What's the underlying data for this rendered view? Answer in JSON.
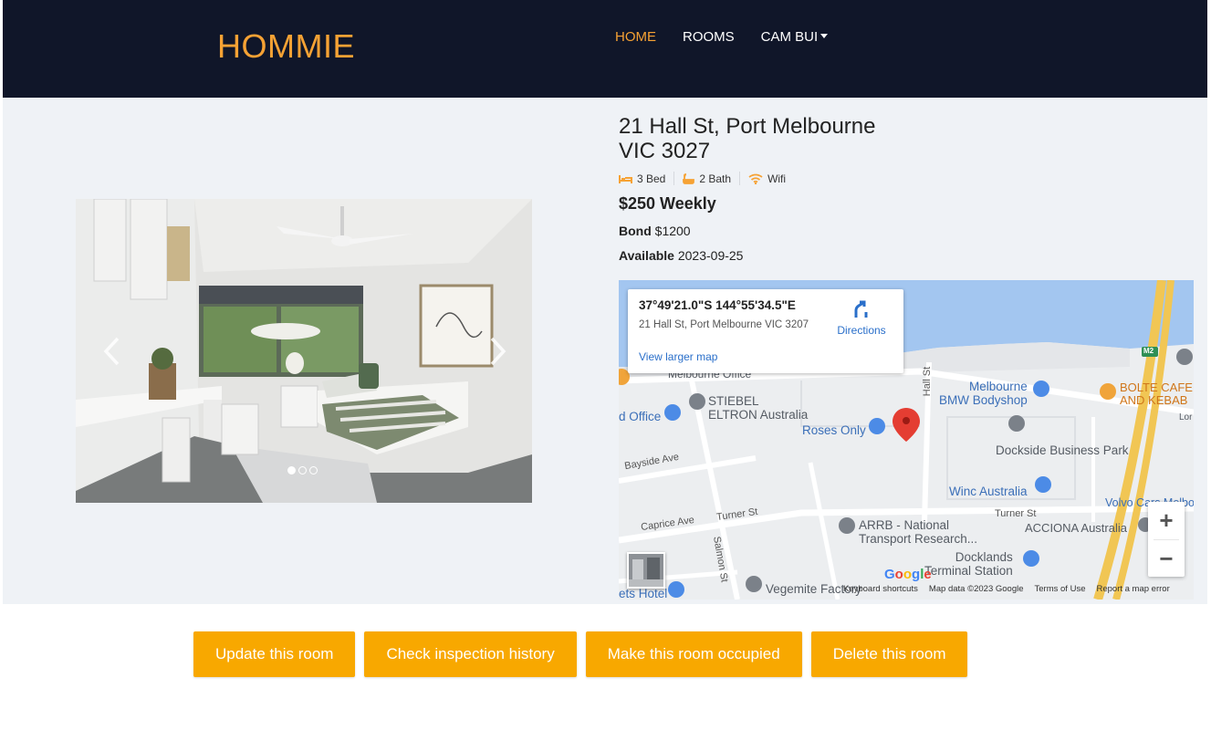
{
  "navbar": {
    "brand": "HOMMIE",
    "links": [
      {
        "label": "HOME",
        "active": true
      },
      {
        "label": "ROOMS",
        "active": false
      },
      {
        "label": "CAM BUI",
        "active": false
      }
    ]
  },
  "carousel": {
    "slide_count": 3,
    "active_index": 0
  },
  "listing": {
    "address_line1": "21 Hall St, Port Melbourne",
    "address_line2": "VIC 3027",
    "features": [
      {
        "icon": "bed-icon",
        "label": "3 Bed"
      },
      {
        "icon": "bath-icon",
        "label": "2 Bath"
      },
      {
        "icon": "wifi-icon",
        "label": "Wifi"
      }
    ],
    "price": "$250 Weekly",
    "bond_label": "Bond",
    "bond_value": "$1200",
    "available_label": "Available",
    "available_value": "2023-09-25"
  },
  "map": {
    "coords": "37°49'21.0\"S 144°55'34.5\"E",
    "card_address": "21 Hall St, Port Melbourne VIC 3207",
    "directions_label": "Directions",
    "larger_map_label": "View larger map",
    "zoom_in": "+",
    "zoom_out": "−",
    "google_logo": "Google",
    "attribution": {
      "keyboard": "Keyboard shortcuts",
      "data": "Map data ©2023 Google",
      "terms": "Terms of Use",
      "report": "Report a map error"
    },
    "places": {
      "melbourne_office": "Melbourne Office",
      "d_office": "d Office",
      "stiebel1": "STIEBEL",
      "stiebel2": "ELTRON Australia",
      "roses_only": "Roses Only",
      "bmw1": "Melbourne",
      "bmw2": "BMW Bodyshop",
      "bolte1": "BOLTE CAFE",
      "bolte2": "AND KEBAB",
      "dockside": "Dockside Business Park",
      "winc": "Winc Australia",
      "volvo": "Volvo Cars Melbo",
      "arrb1": "ARRB - National",
      "arrb2": "Transport Research...",
      "acciona": "ACCIONA Australia",
      "docklands1": "Docklands",
      "docklands2": "Terminal Station",
      "vegemite": "Vegemite Factory",
      "ets_hotel": "ets Hotel",
      "m2": "M2",
      "lor": "Lor"
    },
    "roads": {
      "bayside": "Bayside Ave",
      "caprice": "Caprice Ave",
      "turner1": "Turner St",
      "turner2": "Turner St",
      "salmon": "Salmon St",
      "hall": "Hall St"
    }
  },
  "actions": {
    "update": "Update this room",
    "inspection": "Check inspection history",
    "occupied": "Make this room occupied",
    "delete": "Delete this room"
  },
  "colors": {
    "navbar_bg": "#101629",
    "brand": "#f6a234",
    "button_bg": "#f8a800",
    "content_bg": "#eff2f6"
  }
}
